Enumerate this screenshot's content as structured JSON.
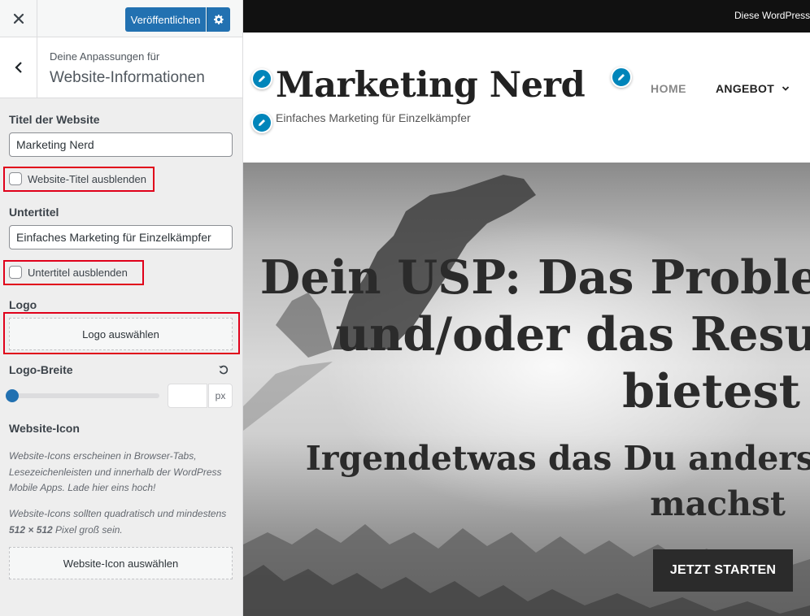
{
  "header": {
    "close_icon": "close-icon",
    "publish_label": "Veröffentlichen",
    "publish_settings_icon": "gear-icon",
    "accent_color": "#2271b1"
  },
  "section": {
    "back_icon": "chevron-left-icon",
    "eyebrow": "Deine Anpassungen für",
    "title": "Website-Informationen"
  },
  "controls": {
    "site_title": {
      "label": "Titel der Website",
      "value": "Marketing Nerd",
      "hide_label": "Website-Titel ausblenden",
      "hide_checked": false
    },
    "tagline": {
      "label": "Untertitel",
      "value": "Einfaches Marketing für Einzelkämpfer",
      "hide_label": "Untertitel ausblenden",
      "hide_checked": false
    },
    "logo": {
      "label": "Logo",
      "button_label": "Logo auswählen"
    },
    "logo_width": {
      "label": "Logo-Breite",
      "reset_icon": "undo-icon",
      "slider_level": 0,
      "value": "",
      "unit": "px"
    },
    "site_icon": {
      "label": "Website-Icon",
      "desc1": "Website-Icons erscheinen in Browser-Tabs, Lesezeichenleisten und innerhalb der WordPress Mobile Apps. Lade hier eins hoch!",
      "desc2_pre": "Website-Icons sollten quadratisch und mindestens ",
      "desc2_bold": "512 × 512",
      "desc2_post": " Pixel groß sein.",
      "button_label": "Website-Icon auswählen"
    },
    "highlight_color": "#e0001a"
  },
  "preview": {
    "admin_bar_text": "Diese WordPress",
    "site_title": "Marketing Nerd",
    "site_tagline": "Einfaches Marketing für Einzelkämpfer",
    "edit_icon": "pencil-icon",
    "nav": {
      "home": "HOME",
      "angebot": "ANGEBOT",
      "dropdown_icon": "chevron-down-icon"
    },
    "hero": {
      "line1": "Dein USP: Das Proble",
      "line2": "und/oder das Resu",
      "line3": "bietest",
      "sub1": "Irgendetwas das Du anders",
      "sub2": "machst",
      "cta": "JETZT STARTEN"
    }
  }
}
